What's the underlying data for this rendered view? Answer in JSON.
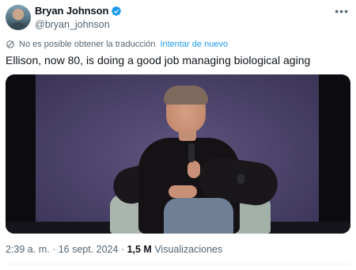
{
  "author": {
    "name": "Bryan Johnson",
    "handle": "@bryan_johnson",
    "verified": true,
    "verified_color": "#1d9bf0"
  },
  "menu": {
    "more_label": "•••"
  },
  "translation": {
    "status_text": "No es posible obtener la traducción",
    "retry_label": "Intentar de nuevo",
    "icon": "no-translate-icon"
  },
  "tweet": {
    "text": "Ellison, now 80, is doing a good job managing biological aging"
  },
  "media": {
    "type": "video",
    "icon": "video-thumbnail"
  },
  "meta": {
    "time": "2:39 a. m.",
    "separator1": " · ",
    "date": "16 sept. 2024",
    "separator2": " · ",
    "views_count": "1,5 M",
    "views_label": " Visualizaciones"
  },
  "colors": {
    "text_primary": "#0f1419",
    "text_secondary": "#536471",
    "link": "#1d9bf0"
  }
}
